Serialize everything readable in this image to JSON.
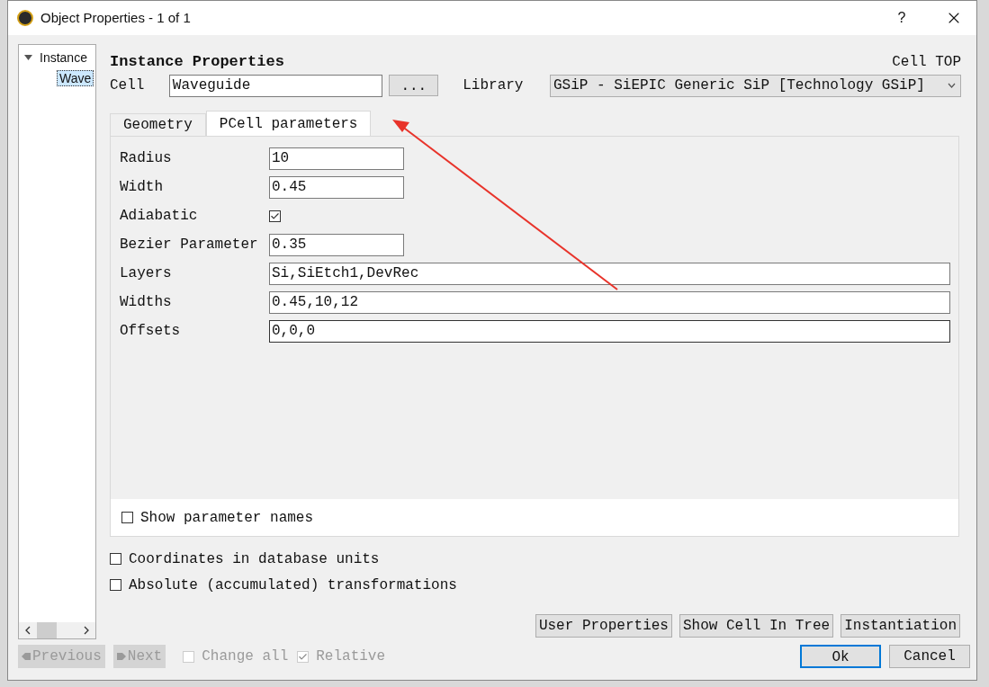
{
  "window": {
    "title": "Object Properties - 1 of 1",
    "help": "?"
  },
  "tree": [
    {
      "label": "Instance",
      "expanded": true,
      "children": [
        {
          "label": "Wave",
          "selected": true
        }
      ]
    }
  ],
  "header": {
    "title": "Instance Properties",
    "cell_top": "Cell TOP",
    "cell_label": "Cell",
    "cell_value": "Waveguide",
    "browse": "...",
    "library_label": "Library",
    "library_value": "GSiP - SiEPIC Generic SiP [Technology GSiP]"
  },
  "tabs": [
    {
      "label": "Geometry",
      "selected": false
    },
    {
      "label": "PCell parameters",
      "selected": true
    }
  ],
  "params": [
    {
      "kind": "short",
      "label": "Radius",
      "value": "10"
    },
    {
      "kind": "short",
      "label": "Width",
      "value": "0.45"
    },
    {
      "kind": "checkbox",
      "label": "Adiabatic",
      "checked": true
    },
    {
      "kind": "short",
      "label": "Bezier Parameter",
      "value": "0.35"
    },
    {
      "kind": "long",
      "label": "Layers",
      "value": "Si,SiEtch1,DevRec"
    },
    {
      "kind": "long",
      "label": "Widths",
      "value": "0.45,10,12"
    },
    {
      "kind": "long",
      "label": "Offsets",
      "value": "0,0,0",
      "focused": true
    }
  ],
  "show_param_names": {
    "label": "Show parameter names",
    "checked": false
  },
  "options": [
    {
      "label": "Coordinates in database units",
      "checked": false
    },
    {
      "label": "Absolute (accumulated) transformations",
      "checked": false
    }
  ],
  "actions": [
    "User Properties",
    "Show Cell In Tree",
    "Instantiation"
  ],
  "nav": [
    {
      "label": "Previous",
      "disabled": true
    },
    {
      "label": "Next",
      "disabled": true
    }
  ],
  "nav_checks": [
    {
      "label": "Change all",
      "checked": false,
      "disabled": true
    },
    {
      "label": "Relative",
      "checked": true,
      "disabled": true
    }
  ],
  "dialog_buttons": [
    {
      "label": "Ok",
      "default": true
    },
    {
      "label": "Cancel",
      "default": false
    }
  ]
}
